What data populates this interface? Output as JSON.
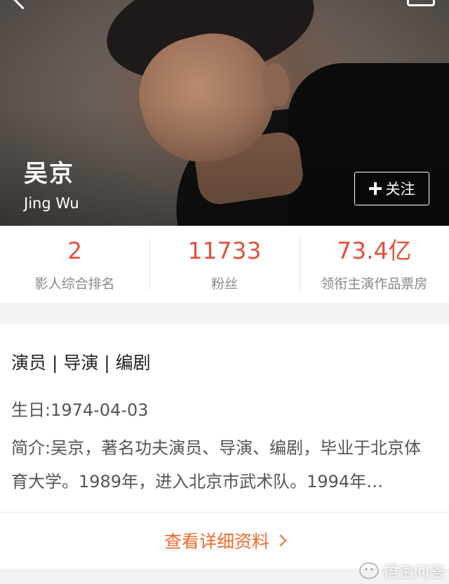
{
  "profile": {
    "name_cn": "吴京",
    "name_en": "Jing Wu",
    "follow_label": "关注"
  },
  "stats": [
    {
      "value": "2",
      "label": "影人综合排名"
    },
    {
      "value": "11733",
      "label": "粉丝"
    },
    {
      "value": "73.4亿",
      "label": "领衔主演作品票房"
    }
  ],
  "info": {
    "roles": "演员 | 导演 | 编剧",
    "birthday": "生日:1974-04-03",
    "intro": "简介:吴京，著名功夫演员、导演、编剧，毕业于北京体育大学。1989年，进入北京市武术队。1994年…"
  },
  "detail_link": "查看详细资料",
  "watermark": "悟空问答",
  "colors": {
    "accent_red": "#e0523c",
    "accent_orange": "#f06a2c"
  }
}
